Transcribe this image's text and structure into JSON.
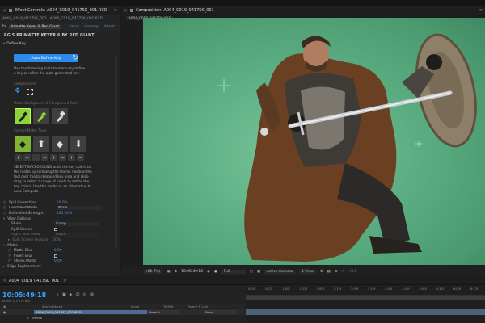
{
  "effect_controls": {
    "title": "Effect Controls: A004_C019_0417SK_001.R3D",
    "path": "A004_C019_0417SK_001 · A004_C019_0417SK_001.R3D",
    "effect_name": "Primatte Keyer & Red Giant",
    "reset": "Reset",
    "licensing": "Licensing...",
    "about": "About...",
    "header": "RG'S PRIMATTE KEYER 6 BY RED GIANT",
    "define_key": "Define Key",
    "auto_define_button": "Auto Define Key",
    "instructions": "Use the following tools to manually define a key or refine the auto generated key.",
    "sample_style": "Sample Style",
    "matte_bg_fg_tools": "Matte Background & Foreground Tools",
    "correct_matte_tools": "Correct Matte Tools",
    "select_bg_text": "SELECT BACKGROUND adds the key colors to the matte by sampling the frame. Position the tool over the background key area and click-drag to select a range of pixels to define the key colors. Use this mode as an alternative to Auto Compute.",
    "spill_correction_label": "Spill Correction",
    "spill_correction_value": "50.0%",
    "desmilled_mode_label": "Desmilled Mode",
    "desmilled_mode_value": "None",
    "desmilled_strength_label": "DeSmilled Strength",
    "desmilled_strength_value": "100.00%",
    "view_options": "View Options",
    "show_label": "Show",
    "show_value": "Comp",
    "split_screen_label": "Split Screen",
    "right_side_show_label": "Right Side Show",
    "right_side_show_value": "Matte",
    "split_screen_feature": "Split Screen Feature",
    "split_screen_feature_value": "50%",
    "matte_label": "Matte",
    "matte_blur_label": "Matte Blur",
    "matte_blur_value": "0.00",
    "invert_blur_label": "Invert Blur",
    "shrink_matte_label": "Shrink Matte",
    "shrink_matte_value": "0.00",
    "edge_replacement_label": "Edge Replacement"
  },
  "composition": {
    "title": "Composition: A004_C019_0417SK_001",
    "tab": "A004_C019_0417SK_001",
    "zoom": "(66.7%)",
    "timecode": "10:05:49:18",
    "resolution": "Full",
    "camera": "Active Camera",
    "view": "1 View",
    "offset": "+0.0"
  },
  "timeline": {
    "tab": "A004_C019_0417SK_001",
    "timecode": "10:05:49:18",
    "timecode_sub": "00000 (23.976 fps)",
    "col_source": "Source Name",
    "col_mode": "Mode",
    "col_trkmat": "TrkMat",
    "col_parent": "Parent & Link",
    "layer_number": "1",
    "layer_name": "A004_C019_0417SK_001.R3D",
    "layer_mode": "Normal",
    "layer_parent": "None",
    "effects_label": "Effects",
    "ruler_marks": [
      "0:00f",
      "0:12f",
      "1:00f",
      "1:12f",
      "2:00f",
      "2:12f",
      "3:00f",
      "3:12f",
      "4:00f",
      "4:12f",
      "5:00f",
      "5:12f",
      "6:00f",
      "6:12f"
    ]
  },
  "colors": {
    "key_green": "#5bae82",
    "accent_blue": "#2d8ceb",
    "tool_active_green": "#8fd33b"
  }
}
